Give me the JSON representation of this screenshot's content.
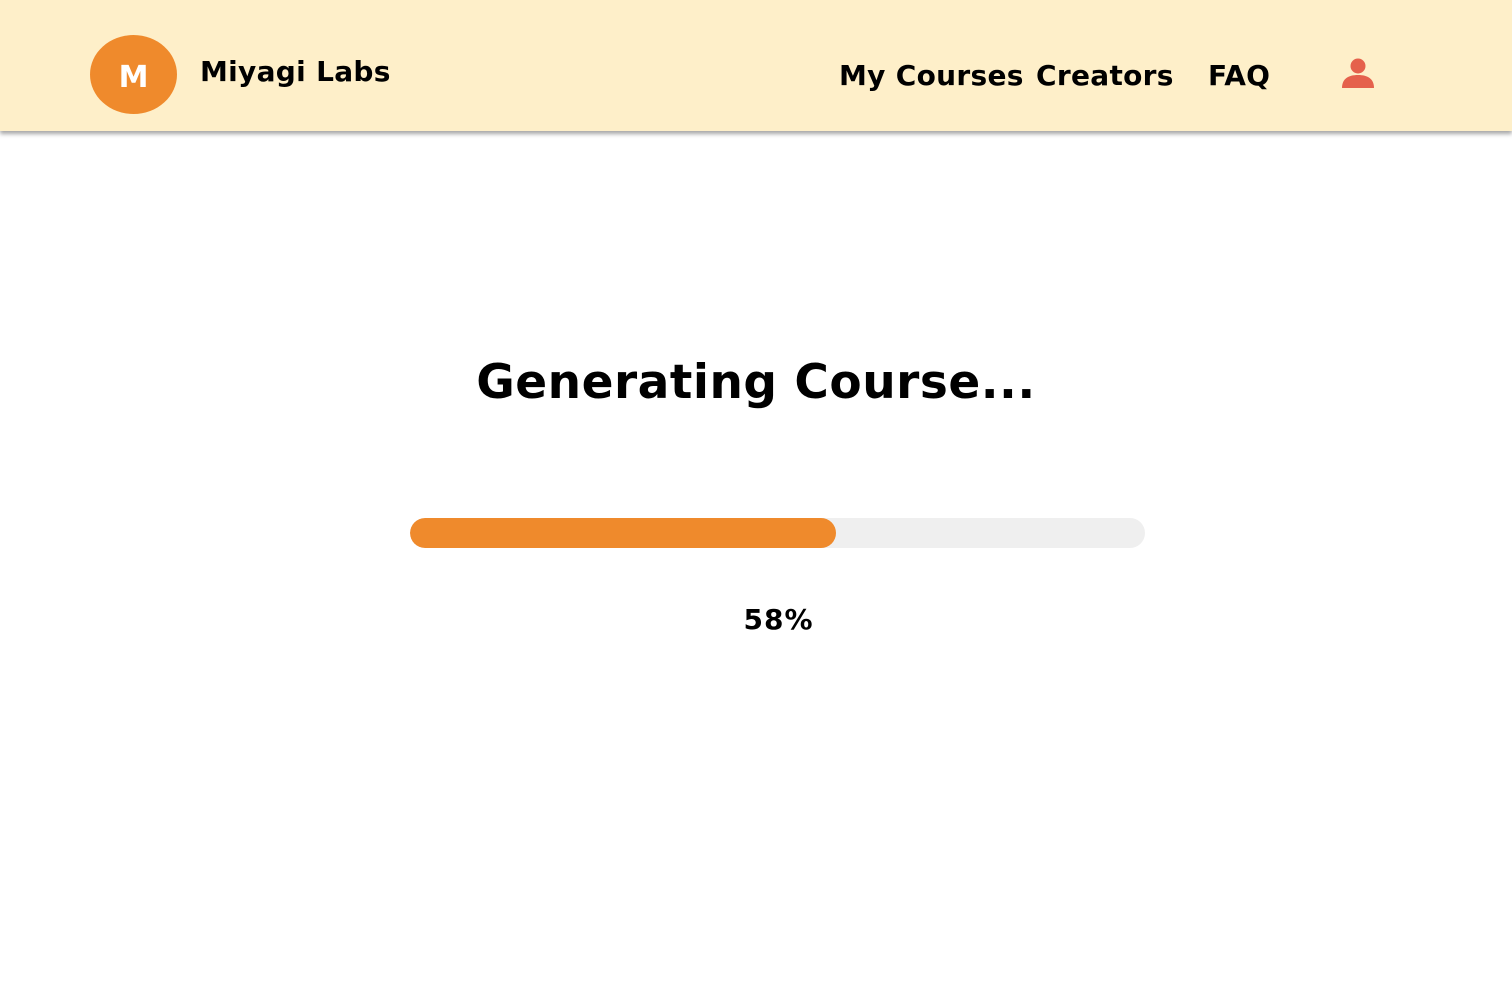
{
  "header": {
    "logo_letter": "M",
    "brand_name": "Miyagi Labs",
    "nav": {
      "my_courses": "My Courses",
      "creators": "Creators",
      "faq": "FAQ"
    },
    "user_icon": "user-icon"
  },
  "main": {
    "title": "Generating Course...",
    "progress_value": 0.58,
    "progress_label": "58%"
  },
  "colors": {
    "accent": "#EF8A2C",
    "header_bg": "#FEEFC9",
    "track_bg": "#EFEFEF",
    "user_icon": "#E5614C"
  }
}
